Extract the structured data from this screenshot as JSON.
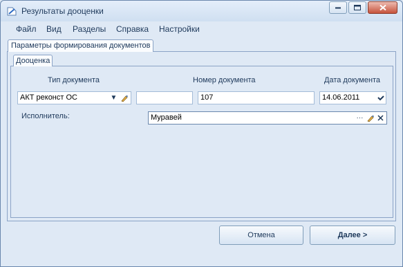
{
  "window": {
    "title": "Результаты дооценки"
  },
  "menu": [
    "Файл",
    "Вид",
    "Разделы",
    "Справка",
    "Настройки"
  ],
  "tabs": {
    "outer": "Параметры формирования документов",
    "inner": "Дооценка"
  },
  "form": {
    "doc_type_label": "Тип документа",
    "doc_type_value": "АКТ реконст ОС",
    "extra_value": "",
    "doc_number_label": "Номер документа",
    "doc_number_value": "107",
    "doc_date_label": "Дата документа",
    "doc_date_value": "14.06.2011",
    "executor_label": "Исполнитель:",
    "executor_value": "Муравей"
  },
  "buttons": {
    "cancel": "Отмена",
    "next": "Далее >"
  }
}
